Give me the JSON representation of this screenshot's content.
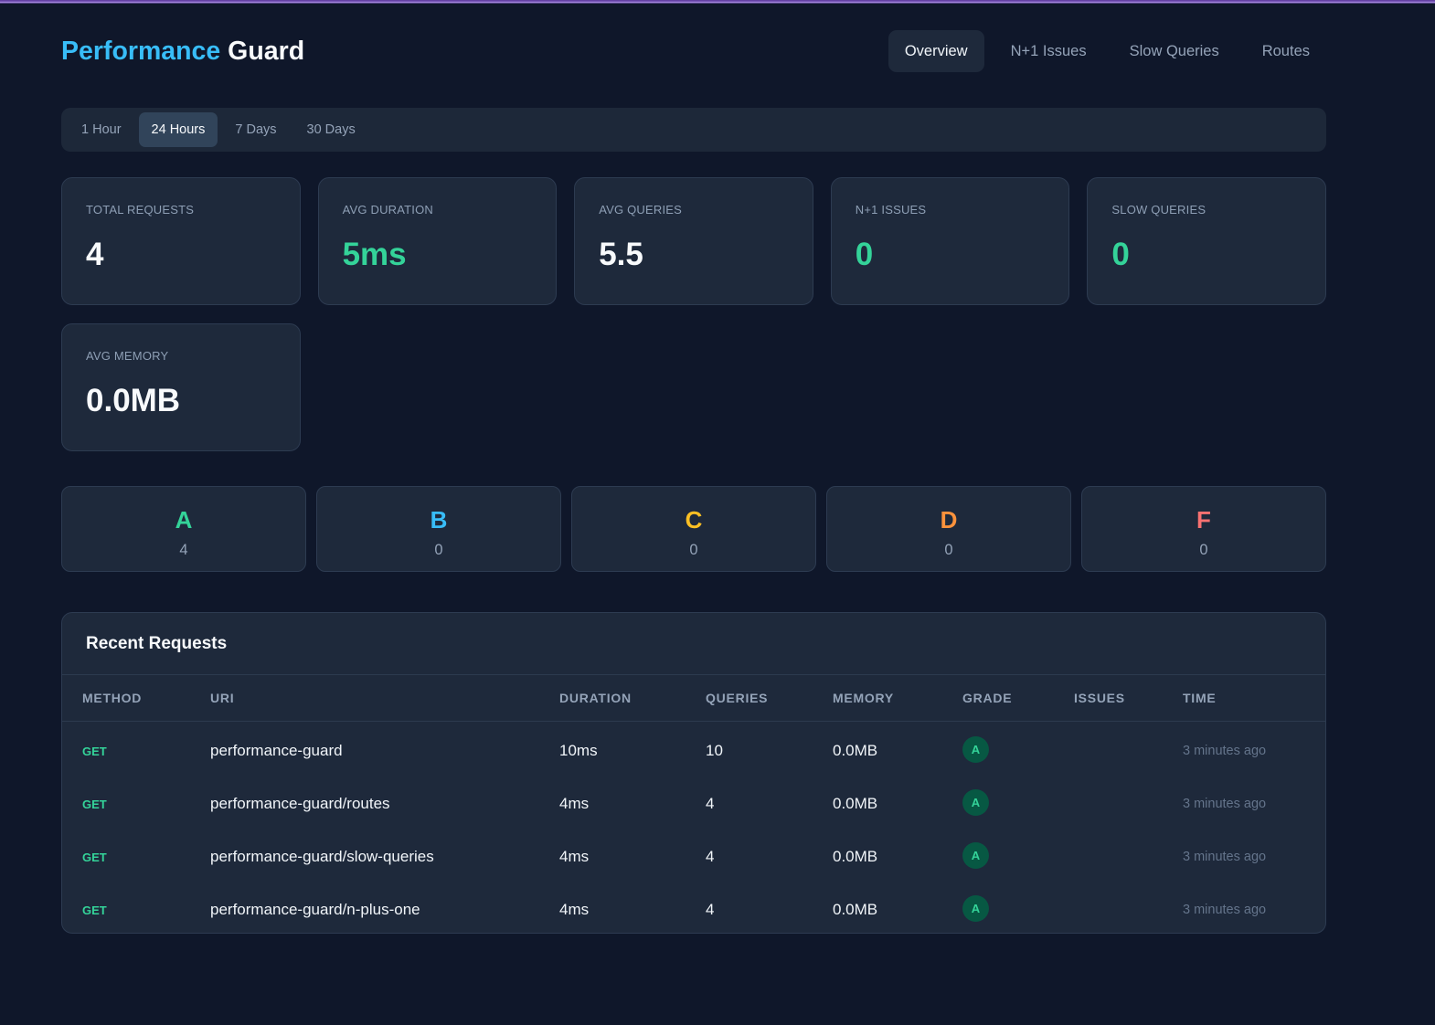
{
  "app": {
    "title_primary": "Performance",
    "title_secondary": "Guard"
  },
  "nav": {
    "items": [
      {
        "label": "Overview",
        "active": true
      },
      {
        "label": "N+1 Issues",
        "active": false
      },
      {
        "label": "Slow Queries",
        "active": false
      },
      {
        "label": "Routes",
        "active": false
      }
    ]
  },
  "time_ranges": {
    "items": [
      {
        "label": "1 Hour",
        "active": false
      },
      {
        "label": "24 Hours",
        "active": true
      },
      {
        "label": "7 Days",
        "active": false
      },
      {
        "label": "30 Days",
        "active": false
      }
    ]
  },
  "stats": [
    {
      "label": "TOTAL REQUESTS",
      "value": "4",
      "color": "#f8fafc"
    },
    {
      "label": "AVG DURATION",
      "value": "5ms",
      "color": "#34d399"
    },
    {
      "label": "AVG QUERIES",
      "value": "5.5",
      "color": "#f8fafc"
    },
    {
      "label": "N+1 ISSUES",
      "value": "0",
      "color": "#34d399"
    },
    {
      "label": "SLOW QUERIES",
      "value": "0",
      "color": "#34d399"
    },
    {
      "label": "AVG MEMORY",
      "value": "0.0MB",
      "color": "#f8fafc"
    }
  ],
  "grades": [
    {
      "letter": "A",
      "count": "4",
      "color": "#34d399"
    },
    {
      "letter": "B",
      "count": "0",
      "color": "#38bdf8"
    },
    {
      "letter": "C",
      "count": "0",
      "color": "#fbbf24"
    },
    {
      "letter": "D",
      "count": "0",
      "color": "#fb923c"
    },
    {
      "letter": "F",
      "count": "0",
      "color": "#f87171"
    }
  ],
  "recent_requests": {
    "title": "Recent Requests",
    "columns": [
      "METHOD",
      "URI",
      "DURATION",
      "QUERIES",
      "MEMORY",
      "GRADE",
      "ISSUES",
      "TIME"
    ],
    "rows": [
      {
        "method": "GET",
        "uri": "performance-guard",
        "duration": "10ms",
        "queries": "10",
        "memory": "0.0MB",
        "grade": "A",
        "issues": "",
        "time": "3 minutes ago"
      },
      {
        "method": "GET",
        "uri": "performance-guard/routes",
        "duration": "4ms",
        "queries": "4",
        "memory": "0.0MB",
        "grade": "A",
        "issues": "",
        "time": "3 minutes ago"
      },
      {
        "method": "GET",
        "uri": "performance-guard/slow-queries",
        "duration": "4ms",
        "queries": "4",
        "memory": "0.0MB",
        "grade": "A",
        "issues": "",
        "time": "3 minutes ago"
      },
      {
        "method": "GET",
        "uri": "performance-guard/n-plus-one",
        "duration": "4ms",
        "queries": "4",
        "memory": "0.0MB",
        "grade": "A",
        "issues": "",
        "time": "3 minutes ago"
      }
    ]
  },
  "colors": {
    "page_background": "#0f172a",
    "card_background": "#1e293b",
    "card_border": "#2e3c52",
    "accent_blue": "#38bdf8",
    "accent_green": "#34d399",
    "muted_text": "#94a3b8",
    "grade_badge_background": "#0d5235",
    "top_bar_purple": "#8a63c9"
  }
}
